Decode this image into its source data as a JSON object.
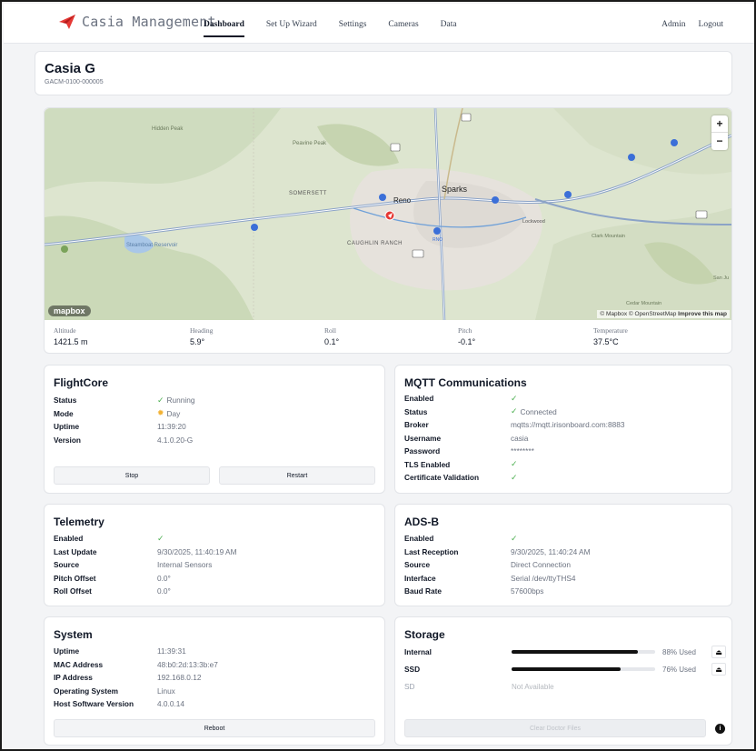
{
  "app": {
    "brand": "Casia Management",
    "nav": [
      "Dashboard",
      "Set Up Wizard",
      "Settings",
      "Cameras",
      "Data"
    ],
    "active_nav": "Dashboard",
    "user": "Admin",
    "logout": "Logout"
  },
  "device": {
    "name": "Casia G",
    "serial": "GACM-0100-000005"
  },
  "map": {
    "places": [
      "Peavine Peak",
      "SOMERSETT",
      "Reno",
      "Sparks",
      "CAUGHLIN RANCH",
      "Lockwood",
      "Clark Mountain",
      "Steamboat Reservoir",
      "Cedar Mountain",
      "San Ju",
      "Hidden Peak"
    ],
    "shields": [
      "80",
      "395",
      "80",
      "580",
      "80",
      "439",
      "80",
      "80",
      "80"
    ],
    "airport": "RNO",
    "attribution_pre": "© Mapbox © OpenStreetMap",
    "attribution_link": "Improve this map",
    "logo": "mapbox",
    "zoom_in": "+",
    "zoom_out": "−"
  },
  "telemetry_strip": [
    {
      "label": "Altitude",
      "value": "1421.5 m"
    },
    {
      "label": "Heading",
      "value": "5.9°"
    },
    {
      "label": "Roll",
      "value": "0.1°"
    },
    {
      "label": "Pitch",
      "value": "-0.1°"
    },
    {
      "label": "Temperature",
      "value": "37.5°C"
    }
  ],
  "flightcore": {
    "title": "FlightCore",
    "rows": [
      {
        "k": "Status",
        "v": "Running"
      },
      {
        "k": "Mode",
        "v": "Day"
      },
      {
        "k": "Uptime",
        "v": "11:39:20"
      },
      {
        "k": "Version",
        "v": "4.1.0.20-G"
      }
    ],
    "stop": "Stop",
    "restart": "Restart"
  },
  "mqtt": {
    "title": "MQTT Communications",
    "rows": [
      {
        "k": "Enabled",
        "v": ""
      },
      {
        "k": "Status",
        "v": "Connected"
      },
      {
        "k": "Broker",
        "v": "mqtts://mqtt.irisonboard.com:8883"
      },
      {
        "k": "Username",
        "v": "casia"
      },
      {
        "k": "Password",
        "v": "********"
      },
      {
        "k": "TLS Enabled",
        "v": ""
      },
      {
        "k": "Certificate Validation",
        "v": ""
      }
    ]
  },
  "telemetry": {
    "title": "Telemetry",
    "rows": [
      {
        "k": "Enabled",
        "v": ""
      },
      {
        "k": "Last Update",
        "v": "9/30/2025, 11:40:19 AM"
      },
      {
        "k": "Source",
        "v": "Internal Sensors"
      },
      {
        "k": "Pitch Offset",
        "v": "0.0°"
      },
      {
        "k": "Roll Offset",
        "v": "0.0°"
      }
    ]
  },
  "adsb": {
    "title": "ADS-B",
    "rows": [
      {
        "k": "Enabled",
        "v": ""
      },
      {
        "k": "Last Reception",
        "v": "9/30/2025, 11:40:24 AM"
      },
      {
        "k": "Source",
        "v": "Direct Connection"
      },
      {
        "k": "Interface",
        "v": "Serial /dev/ttyTHS4"
      },
      {
        "k": "Baud Rate",
        "v": "57600bps"
      }
    ]
  },
  "system": {
    "title": "System",
    "rows": [
      {
        "k": "Uptime",
        "v": "11:39:31"
      },
      {
        "k": "MAC Address",
        "v": "48:b0:2d:13:3b:e7"
      },
      {
        "k": "IP Address",
        "v": "192.168.0.12"
      },
      {
        "k": "Operating System",
        "v": "Linux"
      },
      {
        "k": "Host Software Version",
        "v": "4.0.0.14"
      }
    ],
    "reboot": "Reboot"
  },
  "storage": {
    "title": "Storage",
    "internal": {
      "label": "Internal",
      "used_pct": 88,
      "text": "88% Used"
    },
    "ssd": {
      "label": "SSD",
      "used_pct": 76,
      "text": "76% Used"
    },
    "sd": {
      "label": "SD",
      "text": "Not Available"
    },
    "clear": "Clear Doctor Files",
    "icons": {
      "eject": "eject-icon",
      "info": "info-icon"
    }
  },
  "colors": {
    "check": "#4caf50",
    "accent": "#e53935",
    "road": "#8ba3c7"
  }
}
